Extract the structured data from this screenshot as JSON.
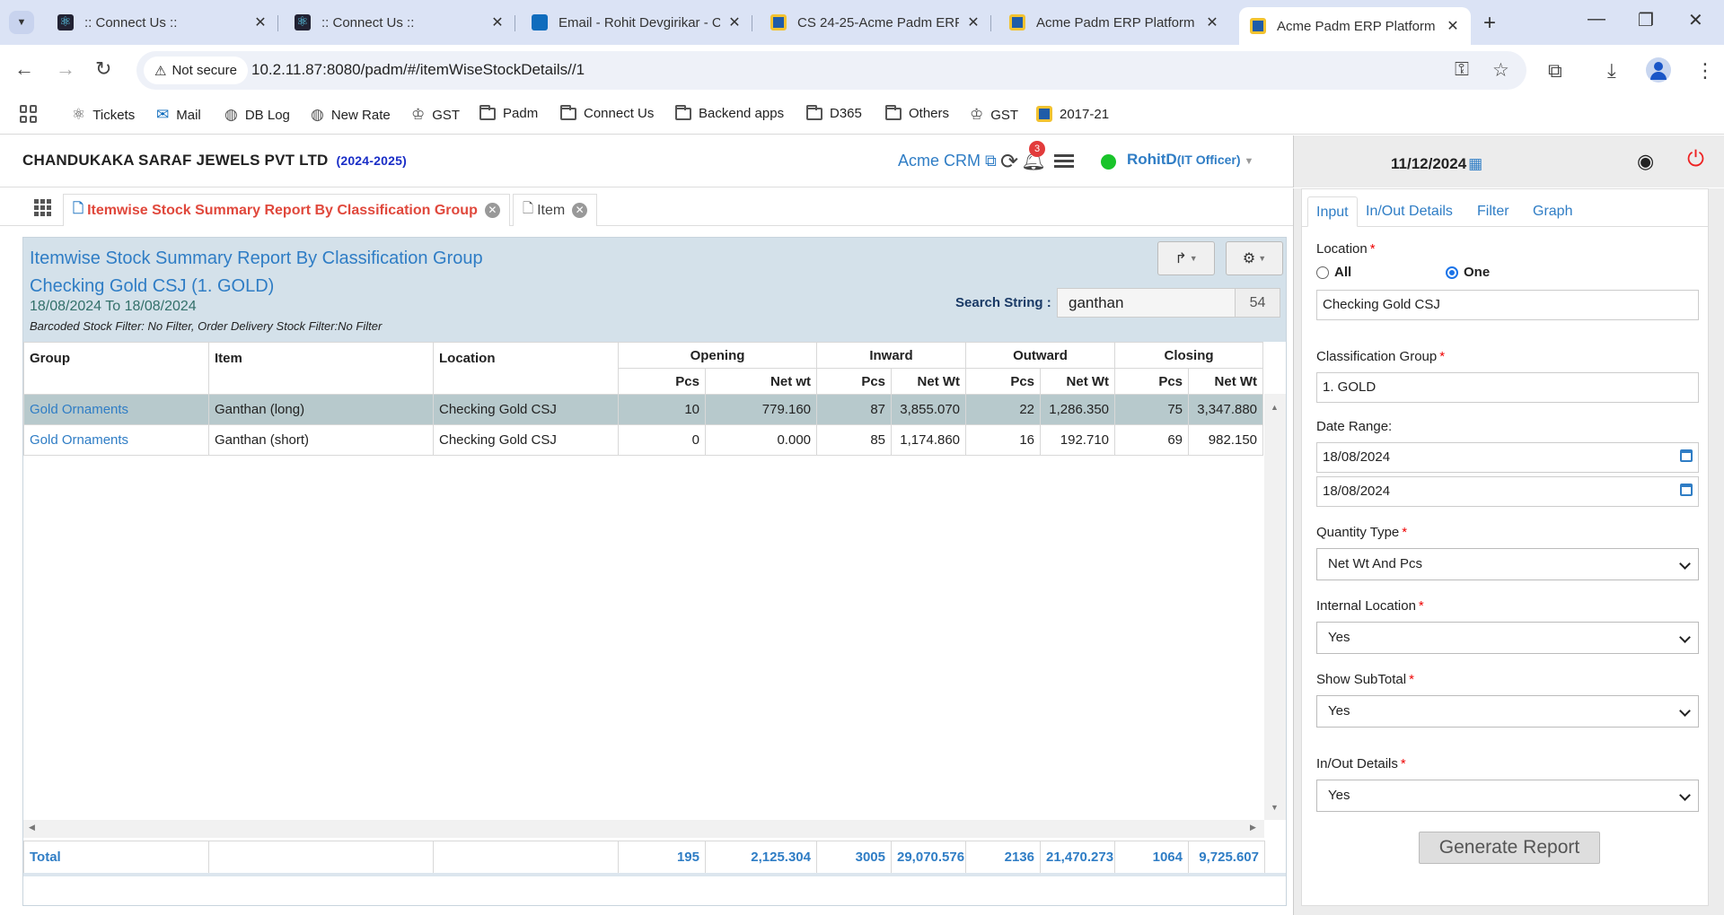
{
  "browser": {
    "tabs": [
      {
        "title": ":: Connect Us ::",
        "favicon": "react-icon"
      },
      {
        "title": ":: Connect Us ::",
        "favicon": "react-icon"
      },
      {
        "title": "Email - Rohit Devgirikar - C",
        "favicon": "outlook-icon"
      },
      {
        "title": "CS 24-25-Acme Padm ERP",
        "favicon": "acme-icon"
      },
      {
        "title": "Acme Padm ERP Platform",
        "favicon": "acme-icon"
      },
      {
        "title": "Acme Padm ERP Platform",
        "favicon": "acme-icon"
      }
    ],
    "security": "Not secure",
    "url": "10.2.11.87:8080/padm/#/itemWiseStockDetails//1",
    "bookmarks": [
      "Tickets",
      "Mail",
      "DB Log",
      "New Rate",
      "GST",
      "Padm",
      "Connect Us",
      "Backend apps",
      "D365",
      "Others",
      "GST",
      "2017-21"
    ]
  },
  "header": {
    "company": "CHANDUKAKA SARAF JEWELS PVT LTD",
    "year": "(2024-2025)",
    "crm_link": "Acme CRM",
    "notification_count": "3",
    "user_name": "RohitD",
    "user_role": "(IT Officer)",
    "date": "11/12/2024"
  },
  "app_tabs": [
    {
      "label": "Itemwise Stock Summary Report By Classification Group"
    },
    {
      "label": "Item"
    }
  ],
  "report": {
    "title": "Itemwise Stock Summary Report By Classification Group",
    "subtitle": "Checking Gold CSJ (1. GOLD)",
    "dates": "18/08/2024 To 18/08/2024",
    "filter_note": "Barcoded Stock Filter: No Filter, Order Delivery Stock Filter:No Filter",
    "search_label": "Search String :",
    "search_value": "ganthan",
    "search_count": "54",
    "headers": {
      "group": "Group",
      "item": "Item",
      "location": "Location",
      "opening": "Opening",
      "inward": "Inward",
      "outward": "Outward",
      "closing": "Closing",
      "pcs": "Pcs",
      "net_wt_lower": "Net wt",
      "net_wt": "Net Wt"
    },
    "rows": [
      {
        "group": "Gold Ornaments",
        "item": "Ganthan (long)",
        "location": "Checking Gold CSJ",
        "op_pcs": "10",
        "op_wt": "779.160",
        "in_pcs": "87",
        "in_wt": "3,855.070",
        "out_pcs": "22",
        "out_wt": "1,286.350",
        "cl_pcs": "75",
        "cl_wt": "3,347.880"
      },
      {
        "group": "Gold Ornaments",
        "item": "Ganthan (short)",
        "location": "Checking Gold CSJ",
        "op_pcs": "0",
        "op_wt": "0.000",
        "in_pcs": "85",
        "in_wt": "1,174.860",
        "out_pcs": "16",
        "out_wt": "192.710",
        "cl_pcs": "69",
        "cl_wt": "982.150"
      }
    ],
    "total": {
      "label": "Total",
      "op_pcs": "195",
      "op_wt": "2,125.304",
      "in_pcs": "3005",
      "in_wt": "29,070.576",
      "out_pcs": "2136",
      "out_wt": "21,470.273",
      "cl_pcs": "1064",
      "cl_wt": "9,725.607"
    }
  },
  "form": {
    "tabs": [
      "Input",
      "In/Out Details",
      "Filter",
      "Graph"
    ],
    "location_label": "Location",
    "radio_all": "All",
    "radio_one": "One",
    "location_value": "Checking Gold CSJ",
    "class_group_label": "Classification Group",
    "class_group_value": "1. GOLD",
    "date_range_label": "Date Range:",
    "date_from": "18/08/2024",
    "date_to": "18/08/2024",
    "qty_type_label": "Quantity Type",
    "qty_type_value": "Net Wt And Pcs",
    "internal_loc_label": "Internal Location",
    "internal_loc_value": "Yes",
    "subtotal_label": "Show SubTotal",
    "subtotal_value": "Yes",
    "inout_label": "In/Out Details",
    "inout_value": "Yes",
    "generate_label": "Generate Report"
  }
}
